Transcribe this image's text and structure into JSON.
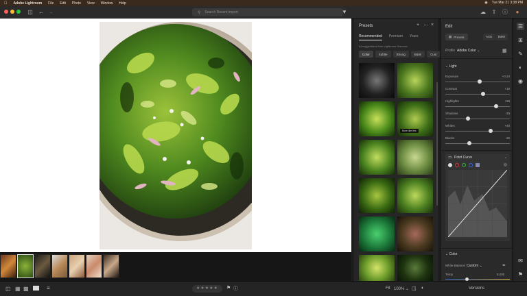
{
  "menubar": {
    "apple_icon": "apple-icon",
    "app_name": "Adobe Lightroom",
    "items": [
      "File",
      "Edit",
      "Photo",
      "View",
      "Window",
      "Help"
    ],
    "datetime": "Tue Mar 21  3:38 PM"
  },
  "toolbar": {
    "search_placeholder": "Search Recent import",
    "traffic_colors": [
      "#ff5f57",
      "#febc2e",
      "#28c840"
    ]
  },
  "presets": {
    "title": "Presets",
    "tabs": [
      "Recommended",
      "Premium",
      "Yours"
    ],
    "subtext": "AI suggestions from Lightroom Discover",
    "categories": [
      "Color",
      "Subtle",
      "Strong",
      "B&W",
      "Cust"
    ],
    "tooltip": "More like this"
  },
  "edit": {
    "title": "Edit",
    "presets_button": "Presets",
    "auto_button": "Auto",
    "bw_button": "B&W",
    "profile_label": "Profile",
    "profile_value": "Adobe Color",
    "light_section": "Light",
    "sliders": [
      {
        "label": "Exposure",
        "value": "+0.24",
        "pos": 0.53
      },
      {
        "label": "Contrast",
        "value": "+18",
        "pos": 0.59
      },
      {
        "label": "Highlights",
        "value": "+58",
        "pos": 0.79
      },
      {
        "label": "Shadows",
        "value": "-30",
        "pos": 0.35
      },
      {
        "label": "Whites",
        "value": "+40",
        "pos": 0.7
      },
      {
        "label": "Blacks",
        "value": "-26",
        "pos": 0.37
      }
    ],
    "point_curve": "Point Curve",
    "color_section": "Color",
    "white_balance_label": "White Balance",
    "white_balance_value": "Custom",
    "temp_label": "Temp",
    "temp_value": "5,000"
  },
  "bottombar": {
    "fit_label": "Fit",
    "zoom_label": "100%",
    "versions_label": "Versions",
    "rating": 0
  }
}
